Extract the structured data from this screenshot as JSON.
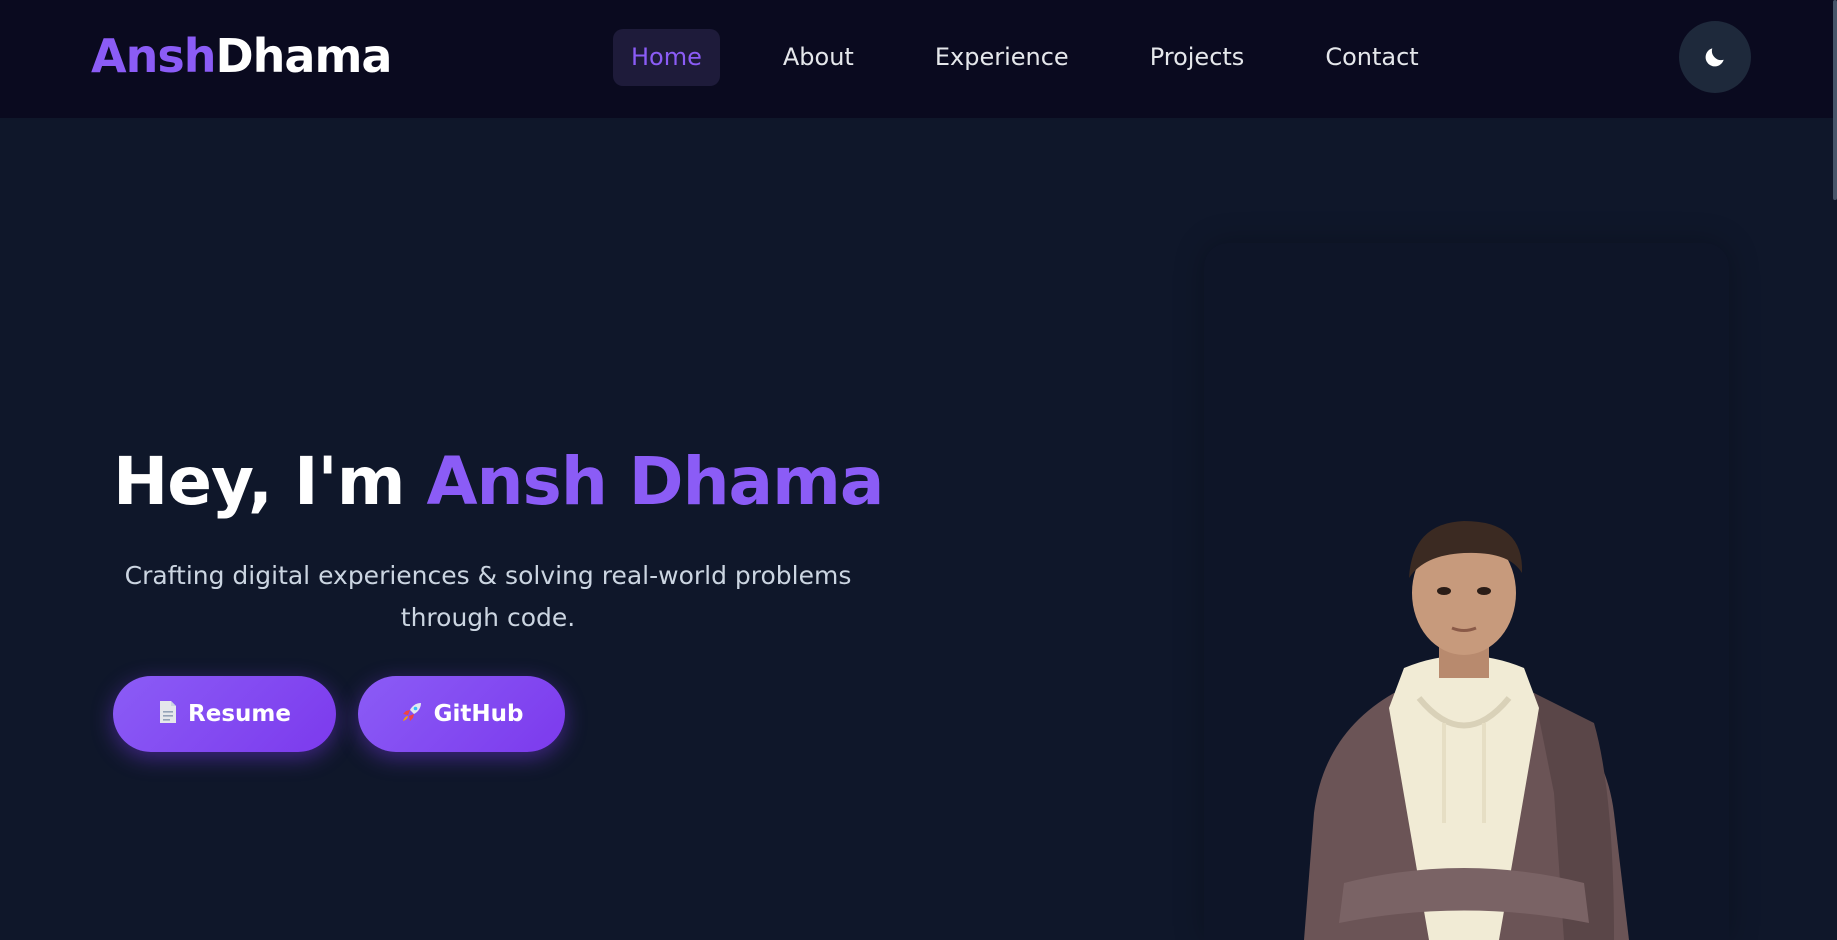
{
  "logo": {
    "first": "Ansh",
    "last": "Dhama"
  },
  "nav": {
    "items": [
      {
        "label": "Home",
        "active": true
      },
      {
        "label": "About",
        "active": false
      },
      {
        "label": "Experience",
        "active": false
      },
      {
        "label": "Projects",
        "active": false
      },
      {
        "label": "Contact",
        "active": false
      }
    ]
  },
  "theme_toggle": {
    "icon": "moon-icon"
  },
  "hero": {
    "title_prefix": "Hey, I'm ",
    "title_name": "Ansh Dhama",
    "subtitle": "Crafting digital experiences & solving real-world problems through code.",
    "buttons": {
      "resume": {
        "icon": "document-icon",
        "label": "Resume"
      },
      "github": {
        "icon": "rocket-icon",
        "label": "GitHub"
      }
    }
  },
  "colors": {
    "accent": "#8b5cf6",
    "background": "#0f172a",
    "navbar": "#0a0a1f"
  }
}
